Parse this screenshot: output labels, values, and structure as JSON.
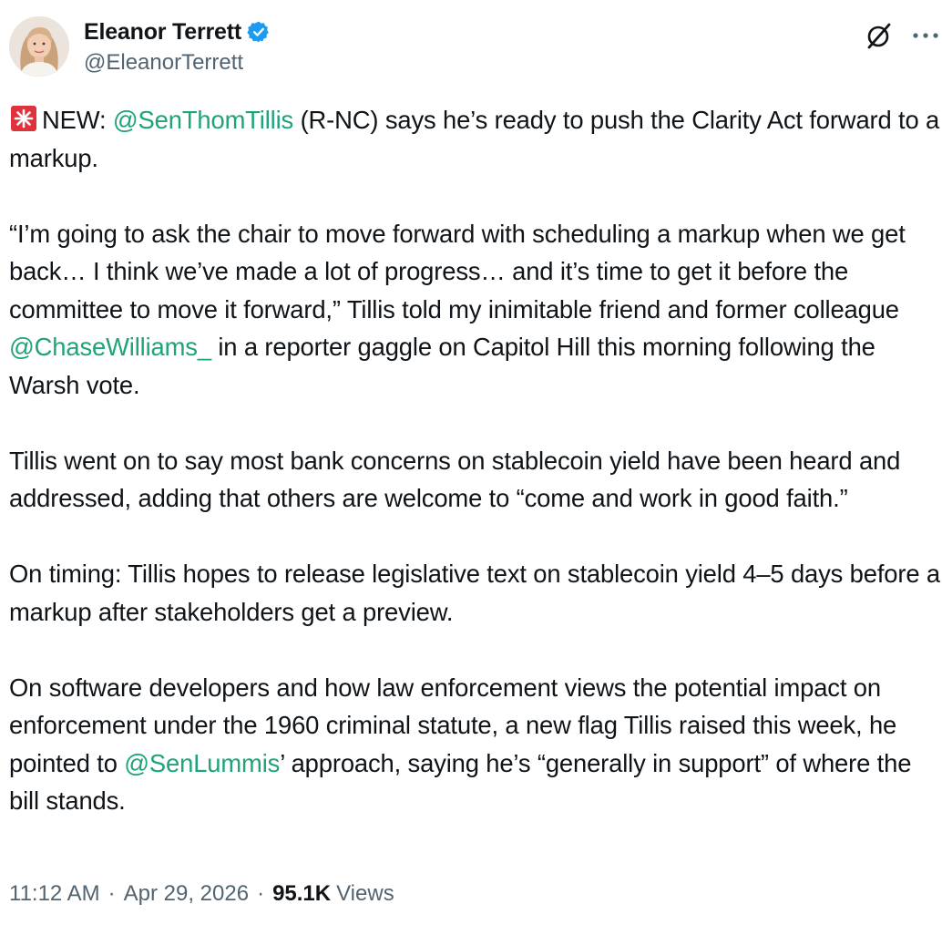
{
  "author": {
    "name": "Eleanor Terrett",
    "handle": "@EleanorTerrett",
    "verified_color": "#1d9bf0"
  },
  "icons": {
    "avatar": "avatar",
    "verified": "verified-badge-icon",
    "grok": "grok-icon",
    "more": "more-options-icon",
    "siren": "siren-emoji-icon"
  },
  "colors": {
    "mention": "#1fa37a",
    "text": "#0f1419",
    "secondary": "#536471"
  },
  "tweet": {
    "p1": {
      "lead": "NEW: ",
      "mention": "@SenThomTillis",
      "rest": " (R-NC) says he’s ready to push the Clarity Act forward to a markup."
    },
    "p2": {
      "part1": "“I’m going to ask the chair to move forward with scheduling a markup when we get back… I think we’ve made a lot of progress… and it’s time to get it before the committee to move it forward,” Tillis told my inimitable friend and former colleague ",
      "mention": "@ChaseWilliams_",
      "part2": " in a reporter gaggle on Capitol Hill this morning following the Warsh vote."
    },
    "p3": "Tillis went on to say most bank concerns on stablecoin yield have been heard and addressed, adding that others are welcome to “come and work in good faith.”",
    "p4": "On timing: Tillis hopes to release legislative text on stablecoin yield 4–5 days before a markup after stakeholders get a preview.",
    "p5": {
      "part1": "On software developers and how law enforcement views the potential impact on enforcement under the 1960 criminal statute, a new flag Tillis raised this week, he pointed to ",
      "mention": "@SenLummis",
      "part2": "’ approach, saying he’s “generally in support” of where the bill stands."
    }
  },
  "meta": {
    "time": "11:12 AM",
    "separator": "·",
    "date": "Apr 29, 2026",
    "views_count": "95.1K",
    "views_label": "Views"
  }
}
